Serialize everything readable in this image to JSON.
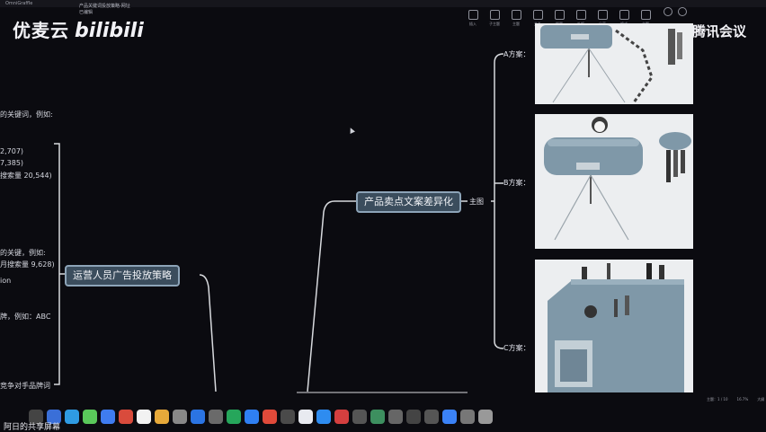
{
  "app": {
    "name": "OmniGraffle",
    "window_title": "产品关键词投放策略-网址",
    "window_subtitle": "已编辑"
  },
  "toolbar": {
    "buttons": [
      "插入",
      "子主题",
      "主题",
      "关系",
      "概要",
      "外框",
      "分享",
      "格式",
      "主题"
    ]
  },
  "watermark": {
    "left_text": "优麦云",
    "left_logo": "bilibili",
    "right_text": "腾讯会议"
  },
  "left_panel_text": [
    "的关键词，例如:",
    "2,707)",
    "7,385)",
    "搜索量 20,544)",
    "的关键，例如:",
    "月搜索量 9,628)",
    "ion",
    "牌，例如：ABC",
    "竞争对手品牌词"
  ],
  "mindmap": {
    "node_left": "运营人员广告投放策略",
    "node_center": "产品卖点文案差异化",
    "connector_label": "主图",
    "branches": [
      {
        "label": "A方案："
      },
      {
        "label": "B方案："
      },
      {
        "label": "C方案："
      }
    ]
  },
  "bottom_bar": {
    "share_label": "阿日的共享屏幕",
    "status": [
      "主题：1 / 10",
      "16.7%",
      "大纲"
    ]
  },
  "colors": {
    "background": "#0b0b10",
    "node_fill": "#3b4d5d",
    "node_border": "#8da4b8",
    "line": "#d8dade"
  }
}
